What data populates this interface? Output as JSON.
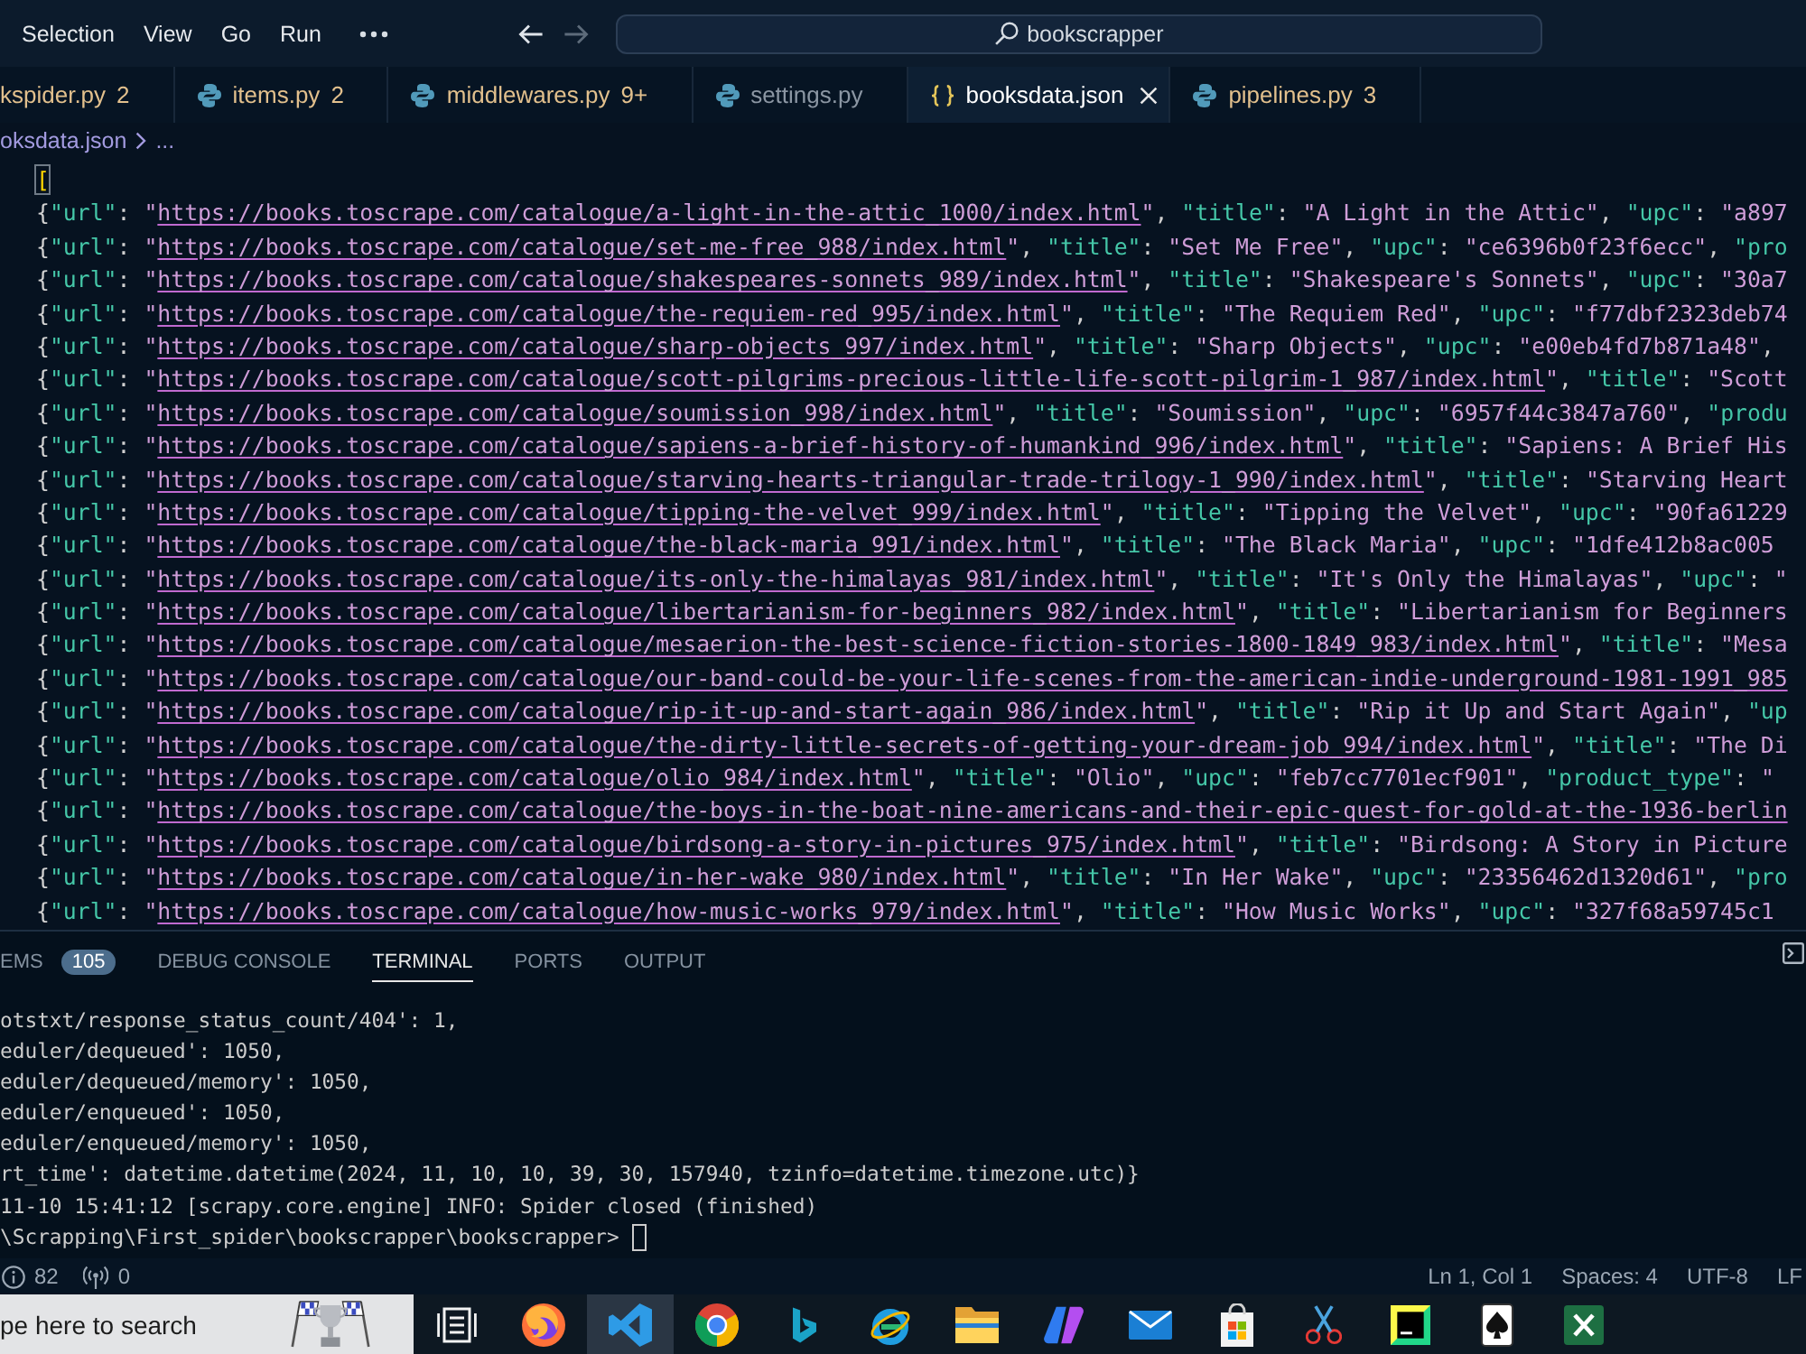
{
  "menu": {
    "items": [
      "Selection",
      "View",
      "Go",
      "Run"
    ]
  },
  "navigation": [
    {
      "kind": "back",
      "disabled": false
    },
    {
      "kind": "forward",
      "disabled": true
    }
  ],
  "command_center": {
    "text": "bookscrapper"
  },
  "tabs": [
    {
      "label": "kspider.py",
      "count": "2",
      "kind": "plain",
      "selected": false
    },
    {
      "label": "items.py",
      "count": "2",
      "kind": "python",
      "selected": false
    },
    {
      "label": "middlewares.py",
      "count": "9+",
      "kind": "python",
      "selected": false
    },
    {
      "label": "settings.py",
      "kind": "python",
      "selected": false
    },
    {
      "label": "booksdata.json",
      "kind": "json",
      "selected": true
    },
    {
      "label": "pipelines.py",
      "count": "3",
      "kind": "python",
      "selected": false
    }
  ],
  "breadcrumb": {
    "items": [
      "oksdata.json",
      "..."
    ]
  },
  "editor": {
    "lines": [
      {
        "tokens": [
          {
            "kind": "bracket",
            "text": "["
          }
        ]
      },
      {
        "tokens": [
          {
            "kind": "punct",
            "text": "{"
          },
          {
            "kind": "key",
            "text": "\"url\""
          },
          {
            "kind": "punct",
            "text": ": "
          },
          {
            "kind": "string",
            "text": "\""
          },
          {
            "kind": "link",
            "text": "https://books.toscrape.com/catalogue/a-light-in-the-attic_1000/index.html"
          },
          {
            "kind": "string",
            "text": "\""
          },
          {
            "kind": "punct",
            "text": ", "
          },
          {
            "kind": "key",
            "text": "\"title\""
          },
          {
            "kind": "punct",
            "text": ": "
          },
          {
            "kind": "string",
            "text": "\"A Light in the Attic\""
          },
          {
            "kind": "punct",
            "text": ", "
          },
          {
            "kind": "key",
            "text": "\"upc\""
          },
          {
            "kind": "punct",
            "text": ": "
          },
          {
            "kind": "string",
            "text": "\"a897"
          }
        ]
      },
      {
        "tokens": [
          {
            "kind": "punct",
            "text": "{"
          },
          {
            "kind": "key",
            "text": "\"url\""
          },
          {
            "kind": "punct",
            "text": ": "
          },
          {
            "kind": "string",
            "text": "\""
          },
          {
            "kind": "link",
            "text": "https://books.toscrape.com/catalogue/set-me-free_988/index.html"
          },
          {
            "kind": "string",
            "text": "\""
          },
          {
            "kind": "punct",
            "text": ", "
          },
          {
            "kind": "key",
            "text": "\"title\""
          },
          {
            "kind": "punct",
            "text": ": "
          },
          {
            "kind": "string",
            "text": "\"Set Me Free\""
          },
          {
            "kind": "punct",
            "text": ", "
          },
          {
            "kind": "key",
            "text": "\"upc\""
          },
          {
            "kind": "punct",
            "text": ": "
          },
          {
            "kind": "string",
            "text": "\"ce6396b0f23f6ecc\""
          },
          {
            "kind": "punct",
            "text": ", "
          },
          {
            "kind": "key",
            "text": "\"pro"
          }
        ]
      },
      {
        "tokens": [
          {
            "kind": "punct",
            "text": "{"
          },
          {
            "kind": "key",
            "text": "\"url\""
          },
          {
            "kind": "punct",
            "text": ": "
          },
          {
            "kind": "string",
            "text": "\""
          },
          {
            "kind": "link",
            "text": "https://books.toscrape.com/catalogue/shakespeares-sonnets_989/index.html"
          },
          {
            "kind": "string",
            "text": "\""
          },
          {
            "kind": "punct",
            "text": ", "
          },
          {
            "kind": "key",
            "text": "\"title\""
          },
          {
            "kind": "punct",
            "text": ": "
          },
          {
            "kind": "string",
            "text": "\"Shakespeare's Sonnets\""
          },
          {
            "kind": "punct",
            "text": ", "
          },
          {
            "kind": "key",
            "text": "\"upc\""
          },
          {
            "kind": "punct",
            "text": ": "
          },
          {
            "kind": "string",
            "text": "\"30a7"
          }
        ]
      },
      {
        "tokens": [
          {
            "kind": "punct",
            "text": "{"
          },
          {
            "kind": "key",
            "text": "\"url\""
          },
          {
            "kind": "punct",
            "text": ": "
          },
          {
            "kind": "string",
            "text": "\""
          },
          {
            "kind": "link",
            "text": "https://books.toscrape.com/catalogue/the-requiem-red_995/index.html"
          },
          {
            "kind": "string",
            "text": "\""
          },
          {
            "kind": "punct",
            "text": ", "
          },
          {
            "kind": "key",
            "text": "\"title\""
          },
          {
            "kind": "punct",
            "text": ": "
          },
          {
            "kind": "string",
            "text": "\"The Requiem Red\""
          },
          {
            "kind": "punct",
            "text": ", "
          },
          {
            "kind": "key",
            "text": "\"upc\""
          },
          {
            "kind": "punct",
            "text": ": "
          },
          {
            "kind": "string",
            "text": "\"f77dbf2323deb74"
          }
        ]
      },
      {
        "tokens": [
          {
            "kind": "punct",
            "text": "{"
          },
          {
            "kind": "key",
            "text": "\"url\""
          },
          {
            "kind": "punct",
            "text": ": "
          },
          {
            "kind": "string",
            "text": "\""
          },
          {
            "kind": "link",
            "text": "https://books.toscrape.com/catalogue/sharp-objects_997/index.html"
          },
          {
            "kind": "string",
            "text": "\""
          },
          {
            "kind": "punct",
            "text": ", "
          },
          {
            "kind": "key",
            "text": "\"title\""
          },
          {
            "kind": "punct",
            "text": ": "
          },
          {
            "kind": "string",
            "text": "\"Sharp Objects\""
          },
          {
            "kind": "punct",
            "text": ", "
          },
          {
            "kind": "key",
            "text": "\"upc\""
          },
          {
            "kind": "punct",
            "text": ": "
          },
          {
            "kind": "string",
            "text": "\"e00eb4fd7b871a48\""
          },
          {
            "kind": "punct",
            "text": ","
          }
        ]
      },
      {
        "tokens": [
          {
            "kind": "punct",
            "text": "{"
          },
          {
            "kind": "key",
            "text": "\"url\""
          },
          {
            "kind": "punct",
            "text": ": "
          },
          {
            "kind": "string",
            "text": "\""
          },
          {
            "kind": "link",
            "text": "https://books.toscrape.com/catalogue/scott-pilgrims-precious-little-life-scott-pilgrim-1_987/index.html"
          },
          {
            "kind": "string",
            "text": "\""
          },
          {
            "kind": "punct",
            "text": ", "
          },
          {
            "kind": "key",
            "text": "\"title\""
          },
          {
            "kind": "punct",
            "text": ": "
          },
          {
            "kind": "string",
            "text": "\"Scott"
          }
        ]
      },
      {
        "tokens": [
          {
            "kind": "punct",
            "text": "{"
          },
          {
            "kind": "key",
            "text": "\"url\""
          },
          {
            "kind": "punct",
            "text": ": "
          },
          {
            "kind": "string",
            "text": "\""
          },
          {
            "kind": "link",
            "text": "https://books.toscrape.com/catalogue/soumission_998/index.html"
          },
          {
            "kind": "string",
            "text": "\""
          },
          {
            "kind": "punct",
            "text": ", "
          },
          {
            "kind": "key",
            "text": "\"title\""
          },
          {
            "kind": "punct",
            "text": ": "
          },
          {
            "kind": "string",
            "text": "\"Soumission\""
          },
          {
            "kind": "punct",
            "text": ", "
          },
          {
            "kind": "key",
            "text": "\"upc\""
          },
          {
            "kind": "punct",
            "text": ": "
          },
          {
            "kind": "string",
            "text": "\"6957f44c3847a760\""
          },
          {
            "kind": "punct",
            "text": ", "
          },
          {
            "kind": "key",
            "text": "\"produ"
          }
        ]
      },
      {
        "tokens": [
          {
            "kind": "punct",
            "text": "{"
          },
          {
            "kind": "key",
            "text": "\"url\""
          },
          {
            "kind": "punct",
            "text": ": "
          },
          {
            "kind": "string",
            "text": "\""
          },
          {
            "kind": "link",
            "text": "https://books.toscrape.com/catalogue/sapiens-a-brief-history-of-humankind_996/index.html"
          },
          {
            "kind": "string",
            "text": "\""
          },
          {
            "kind": "punct",
            "text": ", "
          },
          {
            "kind": "key",
            "text": "\"title\""
          },
          {
            "kind": "punct",
            "text": ": "
          },
          {
            "kind": "string",
            "text": "\"Sapiens: A Brief His"
          }
        ]
      },
      {
        "tokens": [
          {
            "kind": "punct",
            "text": "{"
          },
          {
            "kind": "key",
            "text": "\"url\""
          },
          {
            "kind": "punct",
            "text": ": "
          },
          {
            "kind": "string",
            "text": "\""
          },
          {
            "kind": "link",
            "text": "https://books.toscrape.com/catalogue/starving-hearts-triangular-trade-trilogy-1_990/index.html"
          },
          {
            "kind": "string",
            "text": "\""
          },
          {
            "kind": "punct",
            "text": ", "
          },
          {
            "kind": "key",
            "text": "\"title\""
          },
          {
            "kind": "punct",
            "text": ": "
          },
          {
            "kind": "string",
            "text": "\"Starving Heart"
          }
        ]
      },
      {
        "tokens": [
          {
            "kind": "punct",
            "text": "{"
          },
          {
            "kind": "key",
            "text": "\"url\""
          },
          {
            "kind": "punct",
            "text": ": "
          },
          {
            "kind": "string",
            "text": "\""
          },
          {
            "kind": "link",
            "text": "https://books.toscrape.com/catalogue/tipping-the-velvet_999/index.html"
          },
          {
            "kind": "string",
            "text": "\""
          },
          {
            "kind": "punct",
            "text": ", "
          },
          {
            "kind": "key",
            "text": "\"title\""
          },
          {
            "kind": "punct",
            "text": ": "
          },
          {
            "kind": "string",
            "text": "\"Tipping the Velvet\""
          },
          {
            "kind": "punct",
            "text": ", "
          },
          {
            "kind": "key",
            "text": "\"upc\""
          },
          {
            "kind": "punct",
            "text": ": "
          },
          {
            "kind": "string",
            "text": "\"90fa61229"
          }
        ]
      },
      {
        "tokens": [
          {
            "kind": "punct",
            "text": "{"
          },
          {
            "kind": "key",
            "text": "\"url\""
          },
          {
            "kind": "punct",
            "text": ": "
          },
          {
            "kind": "string",
            "text": "\""
          },
          {
            "kind": "link",
            "text": "https://books.toscrape.com/catalogue/the-black-maria_991/index.html"
          },
          {
            "kind": "string",
            "text": "\""
          },
          {
            "kind": "punct",
            "text": ", "
          },
          {
            "kind": "key",
            "text": "\"title\""
          },
          {
            "kind": "punct",
            "text": ": "
          },
          {
            "kind": "string",
            "text": "\"The Black Maria\""
          },
          {
            "kind": "punct",
            "text": ", "
          },
          {
            "kind": "key",
            "text": "\"upc\""
          },
          {
            "kind": "punct",
            "text": ": "
          },
          {
            "kind": "string",
            "text": "\"1dfe412b8ac005"
          }
        ]
      },
      {
        "tokens": [
          {
            "kind": "punct",
            "text": "{"
          },
          {
            "kind": "key",
            "text": "\"url\""
          },
          {
            "kind": "punct",
            "text": ": "
          },
          {
            "kind": "string",
            "text": "\""
          },
          {
            "kind": "link",
            "text": "https://books.toscrape.com/catalogue/its-only-the-himalayas_981/index.html"
          },
          {
            "kind": "string",
            "text": "\""
          },
          {
            "kind": "punct",
            "text": ", "
          },
          {
            "kind": "key",
            "text": "\"title\""
          },
          {
            "kind": "punct",
            "text": ": "
          },
          {
            "kind": "string",
            "text": "\"It's Only the Himalayas\""
          },
          {
            "kind": "punct",
            "text": ", "
          },
          {
            "kind": "key",
            "text": "\"upc\""
          },
          {
            "kind": "punct",
            "text": ": "
          },
          {
            "kind": "string",
            "text": "\""
          }
        ]
      },
      {
        "tokens": [
          {
            "kind": "punct",
            "text": "{"
          },
          {
            "kind": "key",
            "text": "\"url\""
          },
          {
            "kind": "punct",
            "text": ": "
          },
          {
            "kind": "string",
            "text": "\""
          },
          {
            "kind": "link",
            "text": "https://books.toscrape.com/catalogue/libertarianism-for-beginners_982/index.html"
          },
          {
            "kind": "string",
            "text": "\""
          },
          {
            "kind": "punct",
            "text": ", "
          },
          {
            "kind": "key",
            "text": "\"title\""
          },
          {
            "kind": "punct",
            "text": ": "
          },
          {
            "kind": "string",
            "text": "\"Libertarianism for Beginners"
          }
        ]
      },
      {
        "tokens": [
          {
            "kind": "punct",
            "text": "{"
          },
          {
            "kind": "key",
            "text": "\"url\""
          },
          {
            "kind": "punct",
            "text": ": "
          },
          {
            "kind": "string",
            "text": "\""
          },
          {
            "kind": "link",
            "text": "https://books.toscrape.com/catalogue/mesaerion-the-best-science-fiction-stories-1800-1849_983/index.html"
          },
          {
            "kind": "string",
            "text": "\""
          },
          {
            "kind": "punct",
            "text": ", "
          },
          {
            "kind": "key",
            "text": "\"title\""
          },
          {
            "kind": "punct",
            "text": ": "
          },
          {
            "kind": "string",
            "text": "\"Mesa"
          }
        ]
      },
      {
        "tokens": [
          {
            "kind": "punct",
            "text": "{"
          },
          {
            "kind": "key",
            "text": "\"url\""
          },
          {
            "kind": "punct",
            "text": ": "
          },
          {
            "kind": "string",
            "text": "\""
          },
          {
            "kind": "link",
            "text": "https://books.toscrape.com/catalogue/our-band-could-be-your-life-scenes-from-the-american-indie-underground-1981-1991_985"
          }
        ]
      },
      {
        "tokens": [
          {
            "kind": "punct",
            "text": "{"
          },
          {
            "kind": "key",
            "text": "\"url\""
          },
          {
            "kind": "punct",
            "text": ": "
          },
          {
            "kind": "string",
            "text": "\""
          },
          {
            "kind": "link",
            "text": "https://books.toscrape.com/catalogue/rip-it-up-and-start-again_986/index.html"
          },
          {
            "kind": "string",
            "text": "\""
          },
          {
            "kind": "punct",
            "text": ", "
          },
          {
            "kind": "key",
            "text": "\"title\""
          },
          {
            "kind": "punct",
            "text": ": "
          },
          {
            "kind": "string",
            "text": "\"Rip it Up and Start Again\""
          },
          {
            "kind": "punct",
            "text": ", "
          },
          {
            "kind": "key",
            "text": "\"up"
          }
        ]
      },
      {
        "tokens": [
          {
            "kind": "punct",
            "text": "{"
          },
          {
            "kind": "key",
            "text": "\"url\""
          },
          {
            "kind": "punct",
            "text": ": "
          },
          {
            "kind": "string",
            "text": "\""
          },
          {
            "kind": "link",
            "text": "https://books.toscrape.com/catalogue/the-dirty-little-secrets-of-getting-your-dream-job_994/index.html"
          },
          {
            "kind": "string",
            "text": "\""
          },
          {
            "kind": "punct",
            "text": ", "
          },
          {
            "kind": "key",
            "text": "\"title\""
          },
          {
            "kind": "punct",
            "text": ": "
          },
          {
            "kind": "string",
            "text": "\"The Di"
          }
        ]
      },
      {
        "tokens": [
          {
            "kind": "punct",
            "text": "{"
          },
          {
            "kind": "key",
            "text": "\"url\""
          },
          {
            "kind": "punct",
            "text": ": "
          },
          {
            "kind": "string",
            "text": "\""
          },
          {
            "kind": "link",
            "text": "https://books.toscrape.com/catalogue/olio_984/index.html"
          },
          {
            "kind": "string",
            "text": "\""
          },
          {
            "kind": "punct",
            "text": ", "
          },
          {
            "kind": "key",
            "text": "\"title\""
          },
          {
            "kind": "punct",
            "text": ": "
          },
          {
            "kind": "string",
            "text": "\"Olio\""
          },
          {
            "kind": "punct",
            "text": ", "
          },
          {
            "kind": "key",
            "text": "\"upc\""
          },
          {
            "kind": "punct",
            "text": ": "
          },
          {
            "kind": "string",
            "text": "\"feb7cc7701ecf901\""
          },
          {
            "kind": "punct",
            "text": ", "
          },
          {
            "kind": "key",
            "text": "\"product_type\""
          },
          {
            "kind": "punct",
            "text": ": "
          },
          {
            "kind": "string",
            "text": "\""
          }
        ]
      },
      {
        "tokens": [
          {
            "kind": "punct",
            "text": "{"
          },
          {
            "kind": "key",
            "text": "\"url\""
          },
          {
            "kind": "punct",
            "text": ": "
          },
          {
            "kind": "string",
            "text": "\""
          },
          {
            "kind": "link",
            "text": "https://books.toscrape.com/catalogue/the-boys-in-the-boat-nine-americans-and-their-epic-quest-for-gold-at-the-1936-berlin"
          }
        ]
      },
      {
        "tokens": [
          {
            "kind": "punct",
            "text": "{"
          },
          {
            "kind": "key",
            "text": "\"url\""
          },
          {
            "kind": "punct",
            "text": ": "
          },
          {
            "kind": "string",
            "text": "\""
          },
          {
            "kind": "link",
            "text": "https://books.toscrape.com/catalogue/birdsong-a-story-in-pictures_975/index.html"
          },
          {
            "kind": "string",
            "text": "\""
          },
          {
            "kind": "punct",
            "text": ", "
          },
          {
            "kind": "key",
            "text": "\"title\""
          },
          {
            "kind": "punct",
            "text": ": "
          },
          {
            "kind": "string",
            "text": "\"Birdsong: A Story in Picture"
          }
        ]
      },
      {
        "tokens": [
          {
            "kind": "punct",
            "text": "{"
          },
          {
            "kind": "key",
            "text": "\"url\""
          },
          {
            "kind": "punct",
            "text": ": "
          },
          {
            "kind": "string",
            "text": "\""
          },
          {
            "kind": "link",
            "text": "https://books.toscrape.com/catalogue/in-her-wake_980/index.html"
          },
          {
            "kind": "string",
            "text": "\""
          },
          {
            "kind": "punct",
            "text": ", "
          },
          {
            "kind": "key",
            "text": "\"title\""
          },
          {
            "kind": "punct",
            "text": ": "
          },
          {
            "kind": "string",
            "text": "\"In Her Wake\""
          },
          {
            "kind": "punct",
            "text": ", "
          },
          {
            "kind": "key",
            "text": "\"upc\""
          },
          {
            "kind": "punct",
            "text": ": "
          },
          {
            "kind": "string",
            "text": "\"23356462d1320d61\""
          },
          {
            "kind": "punct",
            "text": ", "
          },
          {
            "kind": "key",
            "text": "\"pro"
          }
        ]
      },
      {
        "tokens": [
          {
            "kind": "punct",
            "text": "{"
          },
          {
            "kind": "key",
            "text": "\"url\""
          },
          {
            "kind": "punct",
            "text": ": "
          },
          {
            "kind": "string",
            "text": "\""
          },
          {
            "kind": "link",
            "text": "https://books.toscrape.com/catalogue/how-music-works_979/index.html"
          },
          {
            "kind": "string",
            "text": "\""
          },
          {
            "kind": "punct",
            "text": ", "
          },
          {
            "kind": "key",
            "text": "\"title\""
          },
          {
            "kind": "punct",
            "text": ": "
          },
          {
            "kind": "string",
            "text": "\"How Music Works\""
          },
          {
            "kind": "punct",
            "text": ", "
          },
          {
            "kind": "key",
            "text": "\"upc\""
          },
          {
            "kind": "punct",
            "text": ": "
          },
          {
            "kind": "string",
            "text": "\"327f68a59745c1"
          }
        ]
      }
    ]
  },
  "panel": {
    "tabs": [
      {
        "label": "EMS",
        "badge": "105",
        "selected": false
      },
      {
        "label": "DEBUG CONSOLE",
        "selected": false
      },
      {
        "label": "TERMINAL",
        "selected": true
      },
      {
        "label": "PORTS",
        "selected": false
      },
      {
        "label": "OUTPUT",
        "selected": false
      }
    ],
    "terminal": {
      "lines": [
        "otstxt/response_status_count/404': 1,",
        "eduler/dequeued': 1050,",
        "eduler/dequeued/memory': 1050,",
        "eduler/enqueued': 1050,",
        "eduler/enqueued/memory': 1050,",
        "rt_time': datetime.datetime(2024, 11, 10, 10, 39, 30, 157940, tzinfo=datetime.timezone.utc)}",
        "11-10 15:41:12 [scrapy.core.engine] INFO: Spider closed (finished)"
      ],
      "prompt": "\\Scrapping\\First_spider\\bookscrapper\\bookscrapper>"
    }
  },
  "status_bar": {
    "left": [
      {
        "kind": "info",
        "text": "82"
      },
      {
        "kind": "ports",
        "text": "0"
      }
    ],
    "right": [
      "Ln 1, Col 1",
      "Spaces: 4",
      "UTF-8",
      "LF"
    ]
  },
  "taskbar": {
    "search": {
      "placeholder": "pe here to search"
    },
    "apps": [
      {
        "kind": "taskview",
        "selected": false
      },
      {
        "kind": "foxglobe",
        "selected": false
      },
      {
        "kind": "ribbon",
        "selected": true
      },
      {
        "kind": "wheel",
        "selected": false
      },
      {
        "kind": "sail",
        "selected": false
      },
      {
        "kind": "orbit",
        "selected": false
      },
      {
        "kind": "folder",
        "selected": false
      },
      {
        "kind": "swirl",
        "selected": false
      },
      {
        "kind": "envelope",
        "selected": false
      },
      {
        "kind": "bag",
        "selected": false
      },
      {
        "kind": "scissors",
        "selected": false
      },
      {
        "kind": "ide",
        "selected": false
      },
      {
        "kind": "cards",
        "selected": false
      },
      {
        "kind": "sheet",
        "selected": false
      }
    ]
  }
}
